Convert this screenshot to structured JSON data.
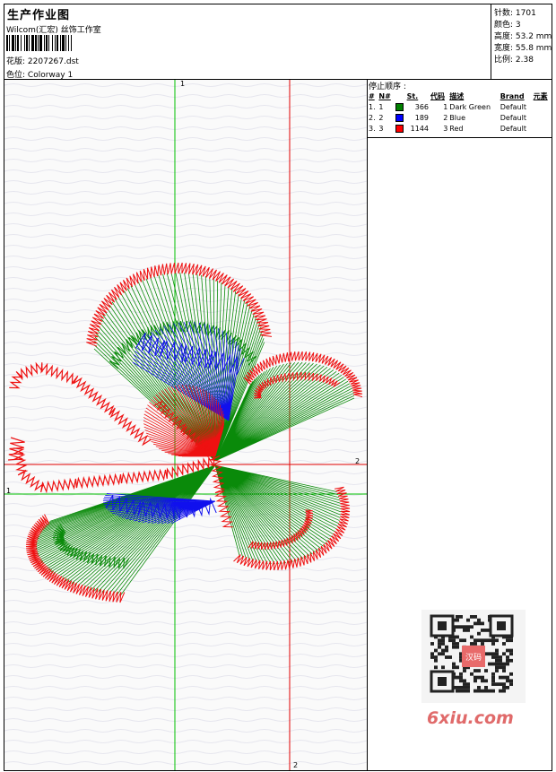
{
  "header": {
    "title": "生产作业图",
    "company": "Wilcom(汇宏) 丝饰工作室",
    "file_label": "花版:",
    "file_name": "2207267.dst",
    "colorway_label": "色位:",
    "colorway_name": "Colorway 1"
  },
  "stats": {
    "stitches": "针数: 1701",
    "colors": "颜色: 3",
    "height": "高度: 53.2 mm",
    "width": "宽度: 55.8 mm",
    "ratio": "比例: 2.38"
  },
  "stop_sequence": {
    "caption": "停止顺序 :",
    "columns": [
      "#",
      "N#",
      "",
      "St.",
      "代码",
      "描述",
      "Brand",
      "元素"
    ],
    "rows": [
      {
        "idx": "1.",
        "n": "1",
        "color": "#008000",
        "st": "366",
        "code": "1",
        "desc": "Dark Green",
        "brand": "Default"
      },
      {
        "idx": "2.",
        "n": "2",
        "color": "#0000ff",
        "st": "189",
        "code": "2",
        "desc": "Blue",
        "brand": "Default"
      },
      {
        "idx": "3.",
        "n": "3",
        "color": "#ff0000",
        "st": "1144",
        "code": "3",
        "desc": "Red",
        "brand": "Default"
      }
    ]
  },
  "canvas": {
    "guide_1_top": "1",
    "guide_1_left": "1",
    "guide_2_right": "2",
    "guide_2_bottom": "2"
  },
  "watermark": {
    "brand": "6xiu.com",
    "stamp": "汉码"
  }
}
